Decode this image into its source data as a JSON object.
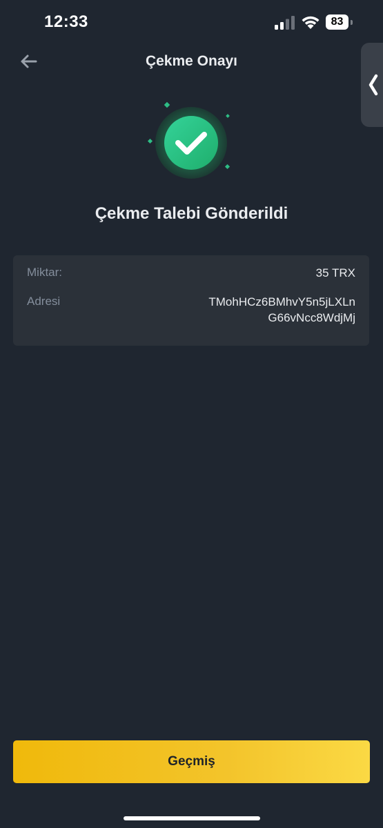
{
  "status_bar": {
    "time": "12:33",
    "battery": "83"
  },
  "header": {
    "title": "Çekme Onayı"
  },
  "result": {
    "title": "Çekme Talebi Gönderildi",
    "icon": "check-circle-icon",
    "accent_color": "#2ebd85"
  },
  "details": {
    "amount_label": "Miktar:",
    "amount_value": "35 TRX",
    "address_label": "Adresi",
    "address_line1": "TMohHCz6BMhvY5n5jLXLn",
    "address_line2": "G66vNcc8WdjMj"
  },
  "actions": {
    "history_label": "Geçmiş",
    "button_color": "#f0b90b"
  }
}
